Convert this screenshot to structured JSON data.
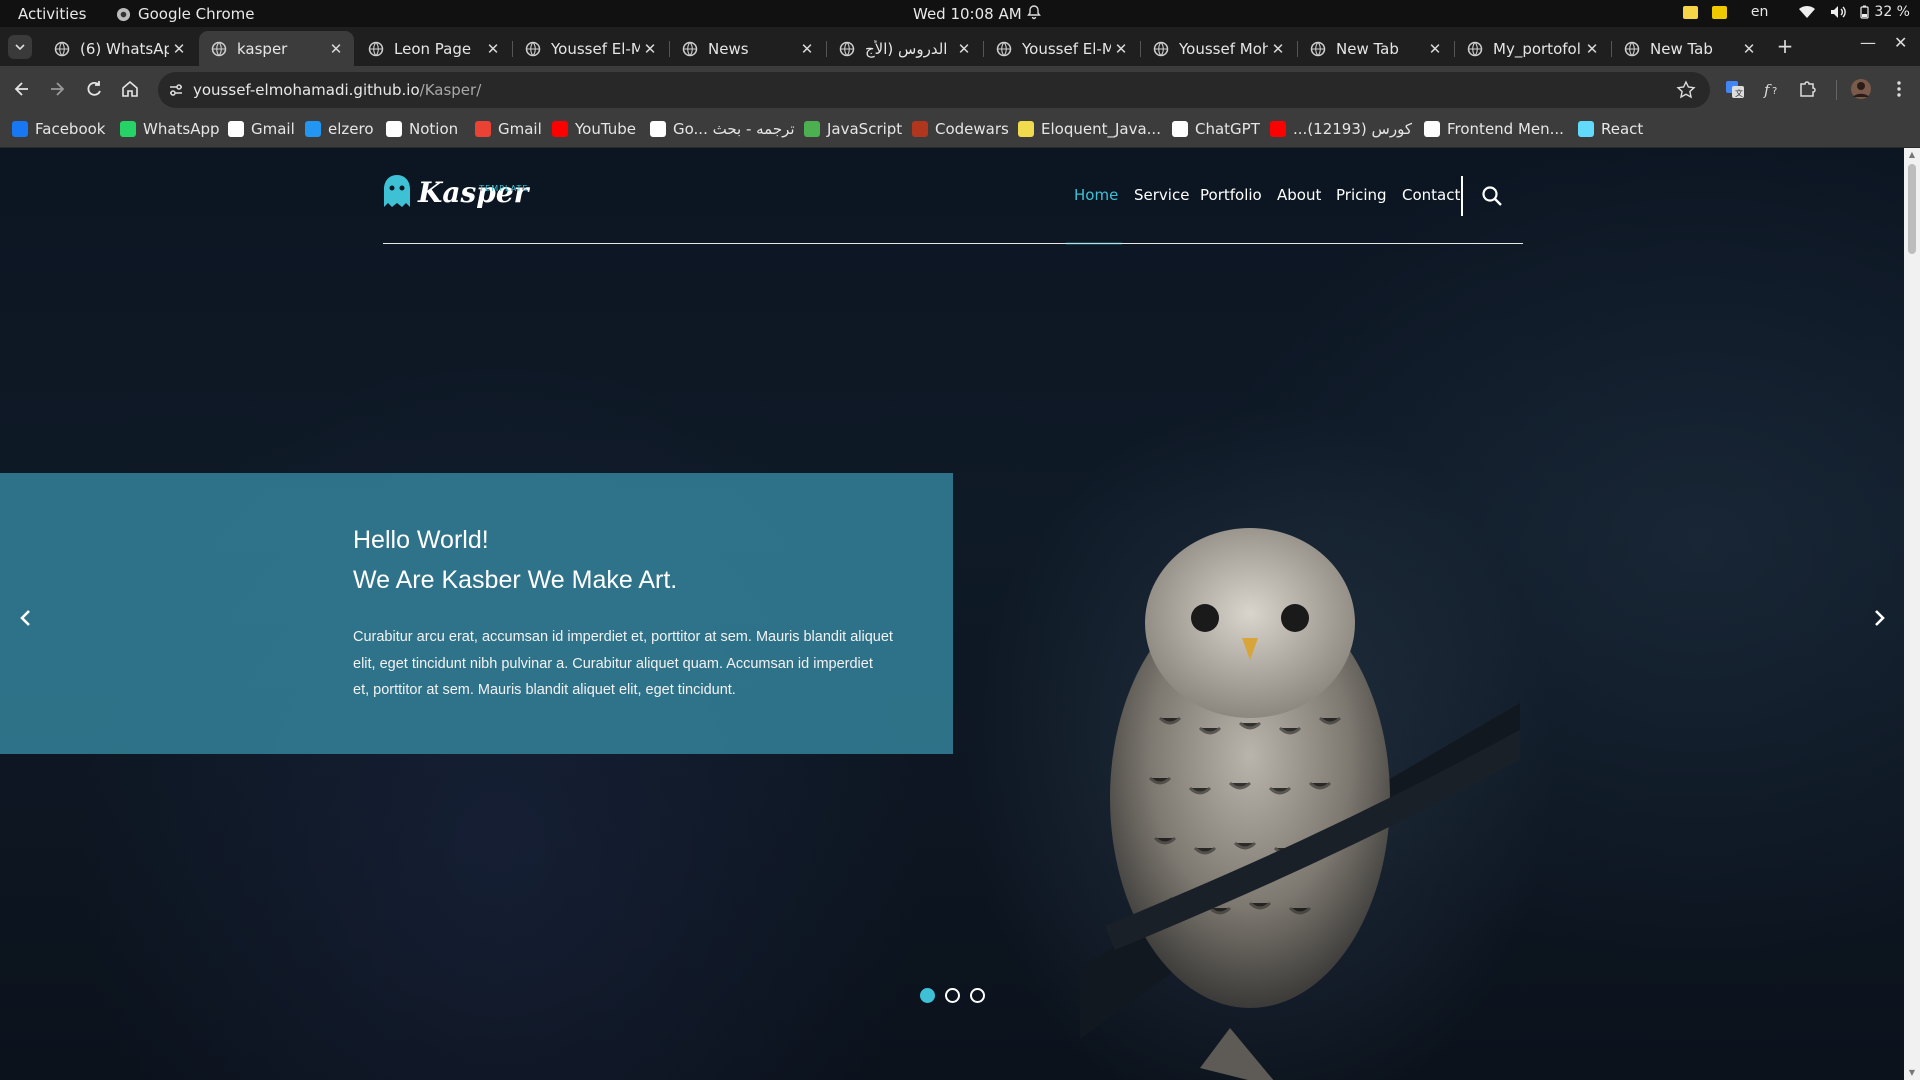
{
  "system": {
    "activities": "Activities",
    "app_name": "Google Chrome",
    "clock": "Wed 10:08 AM",
    "language": "en",
    "battery": "32 %"
  },
  "tabs": [
    {
      "title": "(6) WhatsApp",
      "active": false
    },
    {
      "title": "kasper",
      "active": true
    },
    {
      "title": "Leon Page",
      "active": false
    },
    {
      "title": "Youssef El-M",
      "active": false
    },
    {
      "title": "News",
      "active": false
    },
    {
      "title": "الدروس (الأج",
      "active": false
    },
    {
      "title": "Youssef El-M",
      "active": false
    },
    {
      "title": "Youssef Moh",
      "active": false
    },
    {
      "title": "New Tab",
      "active": false
    },
    {
      "title": "My_portofol",
      "active": false
    },
    {
      "title": "New Tab",
      "active": false
    }
  ],
  "address_bar": {
    "host": "youssef-elmohamadi.github.io",
    "path": "/Kasper/"
  },
  "bookmarks": [
    {
      "label": "Facebook",
      "icon": "facebook-icon",
      "color": "#1877f2"
    },
    {
      "label": "WhatsApp",
      "icon": "whatsapp-icon",
      "color": "#25d366"
    },
    {
      "label": "Gmail",
      "icon": "google-icon",
      "color": "#ffffff"
    },
    {
      "label": "elzero",
      "icon": "elzero-icon",
      "color": "#2196f3"
    },
    {
      "label": "Notion",
      "icon": "notion-icon",
      "color": "#ffffff"
    },
    {
      "label": "Gmail",
      "icon": "gmail-icon",
      "color": "#ea4335"
    },
    {
      "label": "YouTube",
      "icon": "youtube-icon",
      "color": "#ff0000"
    },
    {
      "label": "Go... ترجمه - بحث",
      "icon": "google-icon",
      "color": "#ffffff"
    },
    {
      "label": "JavaScript",
      "icon": "javascript-icon",
      "color": "#4caf50"
    },
    {
      "label": "Codewars",
      "icon": "codewars-icon",
      "color": "#b1361e"
    },
    {
      "label": "Eloquent_Java...",
      "icon": "ejs-icon",
      "color": "#f0db4f"
    },
    {
      "label": "ChatGPT",
      "icon": "chatgpt-icon",
      "color": "#ffffff"
    },
    {
      "label": "...كورس (12193)",
      "icon": "youtube-icon",
      "color": "#ff0000"
    },
    {
      "label": "Frontend Men...",
      "icon": "frontend-mentor-icon",
      "color": "#ffffff"
    },
    {
      "label": "React",
      "icon": "react-icon",
      "color": "#61dafb"
    }
  ],
  "site": {
    "brand": "Kasper",
    "brand_tag": "TEMPLATE",
    "nav": [
      {
        "label": "Home",
        "active": true
      },
      {
        "label": "Service",
        "active": false
      },
      {
        "label": "Portfolio",
        "active": false
      },
      {
        "label": "About",
        "active": false
      },
      {
        "label": "Pricing",
        "active": false
      },
      {
        "label": "Contact",
        "active": false
      }
    ],
    "accent_color": "#3ec1d5",
    "hero": {
      "title_line1": "Hello World!",
      "title_line2": "We Are Kasber We Make Art.",
      "text": "Curabitur arcu erat, accumsan id imperdiet et, porttitor at sem. Mauris blandit aliquet elit, eget tincidunt nibh pulvinar a. Curabitur aliquet quam. Accumsan id imperdiet et, porttitor at sem. Mauris blandit aliquet elit, eget tincidunt."
    },
    "slider": {
      "total": 3,
      "active": 1,
      "prev_icon": "chevron-left-icon",
      "next_icon": "chevron-right-icon"
    }
  }
}
